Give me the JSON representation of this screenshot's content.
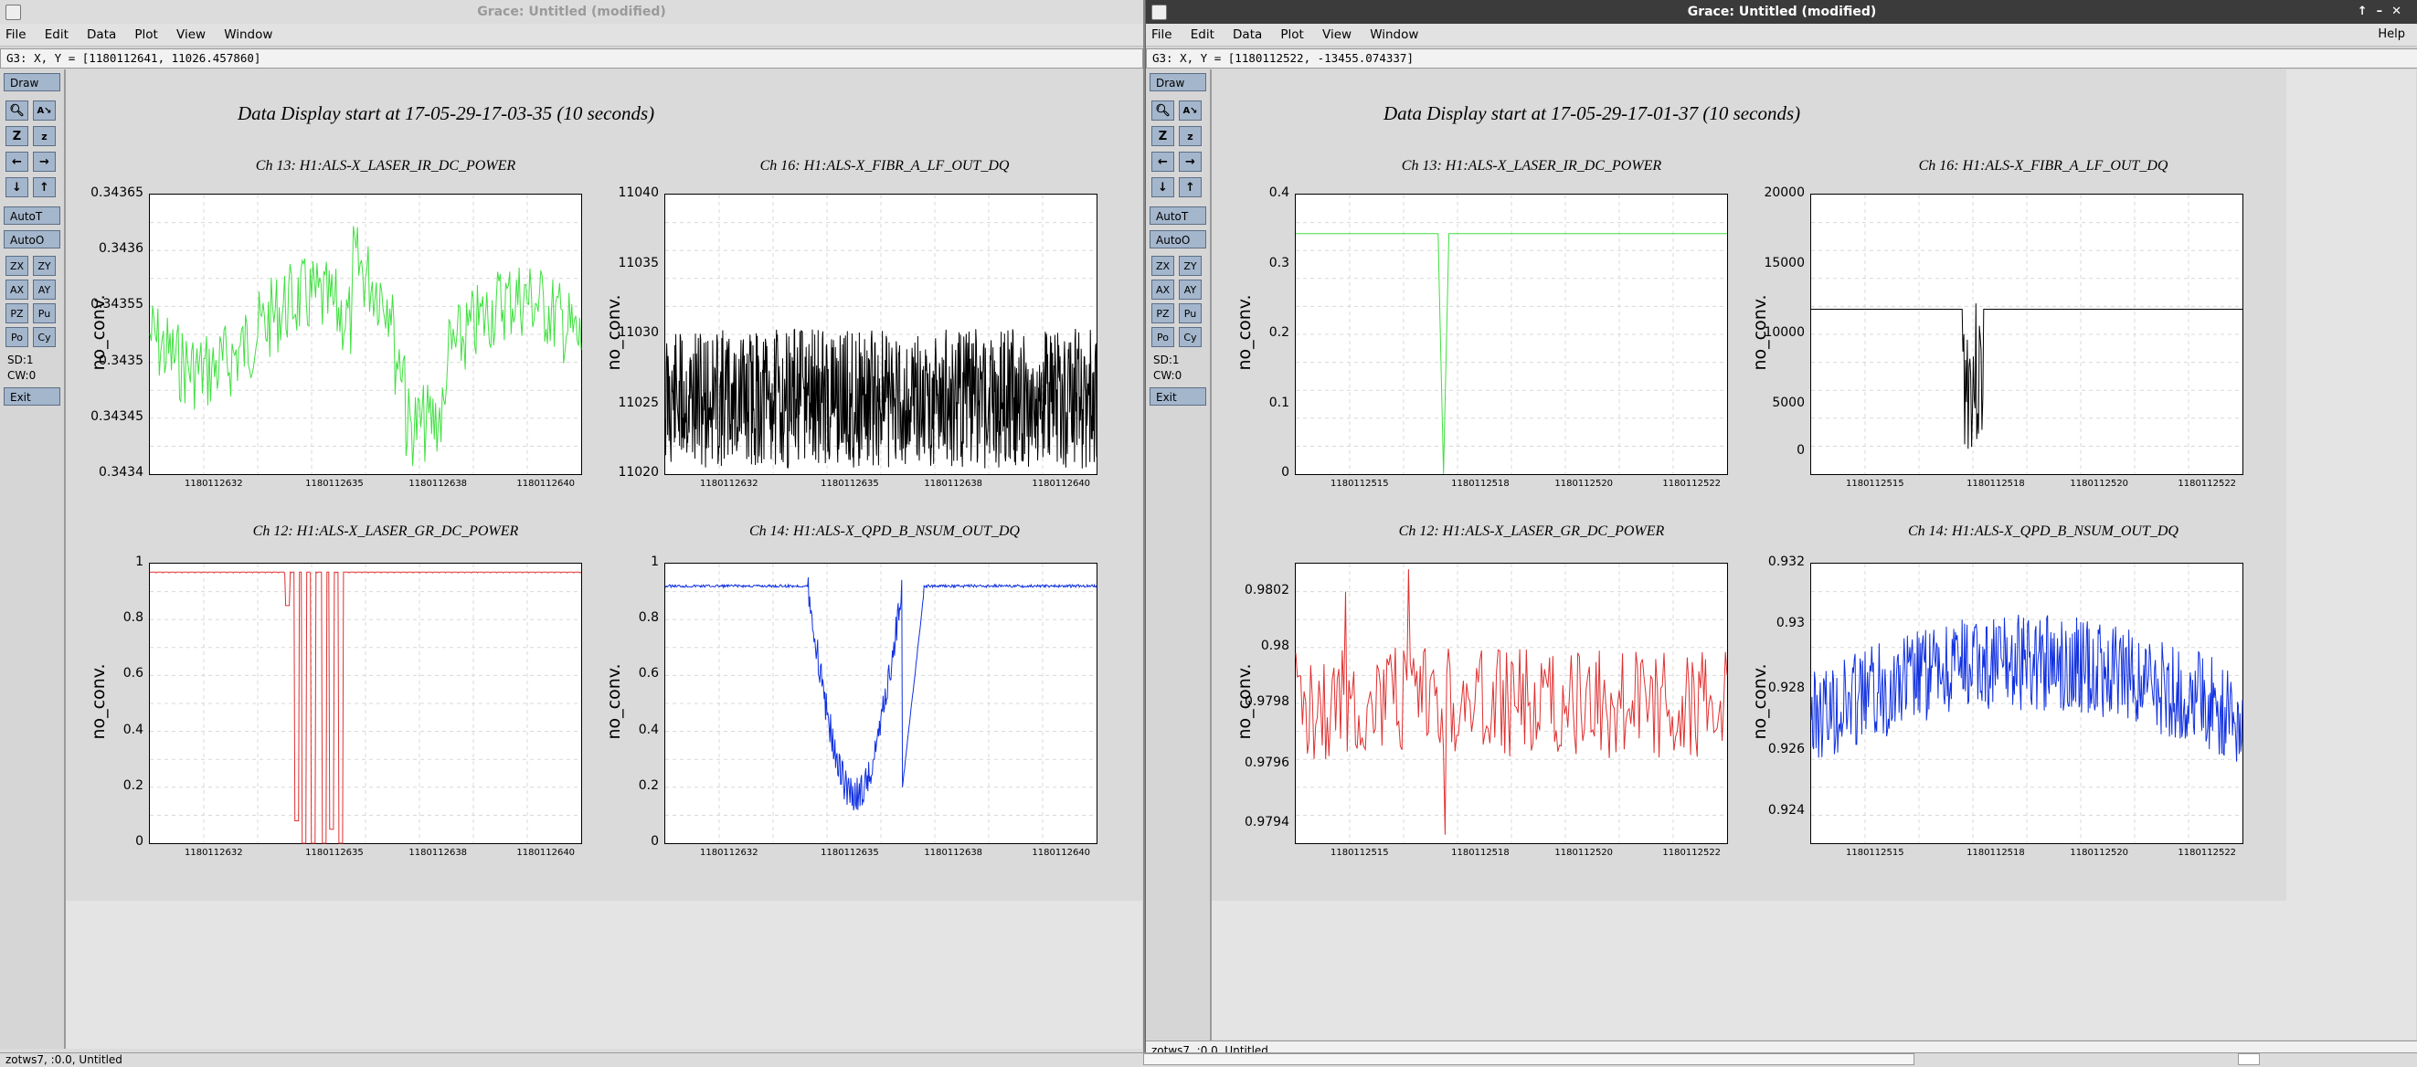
{
  "windows": [
    {
      "id": "A",
      "title": "Grace: Untitled (modified)",
      "menu": [
        "File",
        "Edit",
        "Data",
        "Plot",
        "View",
        "Window"
      ],
      "coords": "G3: X, Y = [1180112641, 11026.457860]",
      "status": "zotws7, :0.0, Untitled",
      "display_title": "Data Display start at 17-05-29-17-03-35 (10 seconds)",
      "plots": [
        {
          "title": "Ch 13: H1:ALS-X_LASER_IR_DC_POWER",
          "ylabel": "no_conv.",
          "color": "#40e040",
          "yticks": [
            "0.34365",
            "0.3436",
            "0.34355",
            "0.3435",
            "0.34345",
            "0.3434"
          ],
          "xticks": [
            "1180112632",
            "1180112635",
            "1180112638",
            "1180112640"
          ]
        },
        {
          "title": "Ch 16: H1:ALS-X_FIBR_A_LF_OUT_DQ",
          "ylabel": "no_conv.",
          "color": "#000000",
          "yticks": [
            "11040",
            "11035",
            "11030",
            "11025",
            "11020"
          ],
          "xticks": [
            "1180112632",
            "1180112635",
            "1180112638",
            "1180112640"
          ]
        },
        {
          "title": "Ch 12: H1:ALS-X_LASER_GR_DC_POWER",
          "ylabel": "no_conv.",
          "color": "#e03030",
          "yticks": [
            "1",
            "0.8",
            "0.6",
            "0.4",
            "0.2",
            "0"
          ],
          "xticks": [
            "1180112632",
            "1180112635",
            "1180112638",
            "1180112640"
          ]
        },
        {
          "title": "Ch 14: H1:ALS-X_QPD_B_NSUM_OUT_DQ",
          "ylabel": "no_conv.",
          "color": "#1030e0",
          "yticks": [
            "1",
            "0.8",
            "0.6",
            "0.4",
            "0.2",
            "0"
          ],
          "xticks": [
            "1180112632",
            "1180112635",
            "1180112638",
            "1180112640"
          ]
        }
      ]
    },
    {
      "id": "B",
      "title": "Grace: Untitled (modified)",
      "menu": [
        "File",
        "Edit",
        "Data",
        "Plot",
        "View",
        "Window"
      ],
      "help": "Help",
      "coords": "G3: X, Y = [1180112522, -13455.074337]",
      "status": "zotws7, :0.0, Untitled",
      "display_title": "Data Display start at 17-05-29-17-01-37 (10 seconds)",
      "plots": [
        {
          "title": "Ch 13: H1:ALS-X_LASER_IR_DC_POWER",
          "ylabel": "no_conv.",
          "color": "#40e040",
          "yticks": [
            "0.4",
            "0.3",
            "0.2",
            "0.1",
            "0"
          ],
          "xticks": [
            "1180112515",
            "1180112518",
            "1180112520",
            "1180112522"
          ]
        },
        {
          "title": "Ch 16: H1:ALS-X_FIBR_A_LF_OUT_DQ",
          "ylabel": "no_conv.",
          "color": "#000000",
          "yticks": [
            "20000",
            "15000",
            "10000",
            "5000",
            "0"
          ],
          "xticks": [
            "1180112515",
            "1180112518",
            "1180112520",
            "1180112522"
          ]
        },
        {
          "title": "Ch 12: H1:ALS-X_LASER_GR_DC_POWER",
          "ylabel": "no_conv.",
          "color": "#e03030",
          "yticks": [
            "0.9802",
            "0.98",
            "0.9798",
            "0.9796",
            "0.9794"
          ],
          "xticks": [
            "1180112515",
            "1180112518",
            "1180112520",
            "1180112522"
          ]
        },
        {
          "title": "Ch 14: H1:ALS-X_QPD_B_NSUM_OUT_DQ",
          "ylabel": "no_conv.",
          "color": "#1030e0",
          "yticks": [
            "0.932",
            "0.93",
            "0.928",
            "0.926",
            "0.924"
          ],
          "xticks": [
            "1180112515",
            "1180112518",
            "1180112520",
            "1180112522"
          ]
        }
      ]
    }
  ],
  "toolbar": {
    "draw": "Draw",
    "autot": "AutoT",
    "autoo": "AutoO",
    "exit": "Exit",
    "sd": "SD:1",
    "cw": "CW:0",
    "icons": [
      "zoom",
      "autoscale-small",
      "zoom-z",
      "zoom-z-small",
      "left",
      "right",
      "down",
      "up"
    ],
    "pairs": [
      [
        "ZX",
        "ZY"
      ],
      [
        "AX",
        "AY"
      ],
      [
        "PZ",
        "Pu"
      ],
      [
        "Po",
        "Cy"
      ]
    ]
  },
  "chart_data": [
    {
      "type": "line",
      "title": "Ch 13: H1:ALS-X_LASER_IR_DC_POWER",
      "ylabel": "no_conv.",
      "ylim": [
        0.3434,
        0.34368
      ],
      "xlim": [
        1180112631,
        1180112641
      ],
      "series": [
        {
          "name": "",
          "values_desc": [
            0.3436,
            0.34355,
            0.34352,
            0.34358,
            0.34352,
            0.34348,
            0.34358,
            0.34362,
            0.34355,
            0.34365,
            0.34358,
            0.34352,
            0.34349,
            0.34345,
            0.3435,
            0.34356,
            0.34353,
            0.34347,
            0.34355
          ]
        }
      ]
    },
    {
      "type": "line",
      "title": "Ch 16: H1:ALS-X_FIBR_A_LF_OUT_DQ",
      "ylabel": "no_conv.",
      "ylim": [
        11020,
        11040
      ],
      "xlim": [
        1180112631,
        1180112641
      ],
      "series": [
        {
          "name": "",
          "values_desc": [
            11025,
            11030,
            11023,
            11029,
            11024,
            11031,
            11025,
            11030,
            11023,
            11028,
            11025,
            11030,
            11024,
            11029
          ]
        }
      ]
    },
    {
      "type": "line",
      "title": "Ch 12: H1:ALS-X_LASER_GR_DC_POWER",
      "ylabel": "no_conv.",
      "ylim": [
        0,
        1
      ],
      "xlim": [
        1180112631,
        1180112641
      ],
      "series": [
        {
          "name": "",
          "values_desc": [
            0.97,
            0.97,
            0.97,
            0.97,
            0.97,
            0.8,
            0.1,
            0.97,
            0,
            0.97,
            0,
            0.97,
            0.97,
            0.97,
            0.97
          ]
        }
      ]
    },
    {
      "type": "line",
      "title": "Ch 14: H1:ALS-X_QPD_B_NSUM_OUT_DQ",
      "ylabel": "no_conv.",
      "ylim": [
        0,
        1
      ],
      "xlim": [
        1180112631,
        1180112641
      ],
      "series": [
        {
          "name": "",
          "values_desc": [
            0.92,
            0.92,
            0.92,
            0.92,
            0.9,
            0.6,
            0.3,
            0.2,
            0.3,
            0.05,
            0.5,
            0.85,
            0.92,
            0.92,
            0.92
          ]
        }
      ]
    },
    {
      "type": "line",
      "title": "Ch 13: H1:ALS-X_LASER_IR_DC_POWER",
      "ylabel": "no_conv.",
      "ylim": [
        0,
        0.4
      ],
      "xlim": [
        1180112513,
        1180112522
      ],
      "series": [
        {
          "name": "",
          "values_desc": [
            0.345,
            0.345,
            0.345,
            0.345,
            0.345,
            0.0,
            0.345,
            0.345,
            0.345,
            0.345
          ]
        }
      ]
    },
    {
      "type": "line",
      "title": "Ch 16: H1:ALS-X_FIBR_A_LF_OUT_DQ",
      "ylabel": "no_conv.",
      "ylim": [
        -500,
        20000
      ],
      "xlim": [
        1180112513,
        1180112522
      ],
      "series": [
        {
          "name": "",
          "values_desc": [
            11000,
            11000,
            11000,
            -500,
            11500,
            10000,
            11000,
            11000,
            11000
          ]
        }
      ]
    },
    {
      "type": "line",
      "title": "Ch 12: H1:ALS-X_LASER_GR_DC_POWER",
      "ylabel": "no_conv.",
      "ylim": [
        0.9793,
        0.9803
      ],
      "xlim": [
        1180112513,
        1180112522
      ],
      "series": [
        {
          "name": "",
          "values_desc": [
            0.9798,
            0.9801,
            0.9797,
            0.9799,
            0.9797,
            0.9803,
            0.9793,
            0.9799,
            0.9797,
            0.9798
          ]
        }
      ]
    },
    {
      "type": "line",
      "title": "Ch 14: H1:ALS-X_QPD_B_NSUM_OUT_DQ",
      "ylabel": "no_conv.",
      "ylim": [
        0.923,
        0.932
      ],
      "xlim": [
        1180112513,
        1180112522
      ],
      "series": [
        {
          "name": "",
          "values_desc": [
            0.925,
            0.927,
            0.928,
            0.929,
            0.928,
            0.93,
            0.929,
            0.931,
            0.928,
            0.925
          ]
        }
      ]
    }
  ]
}
